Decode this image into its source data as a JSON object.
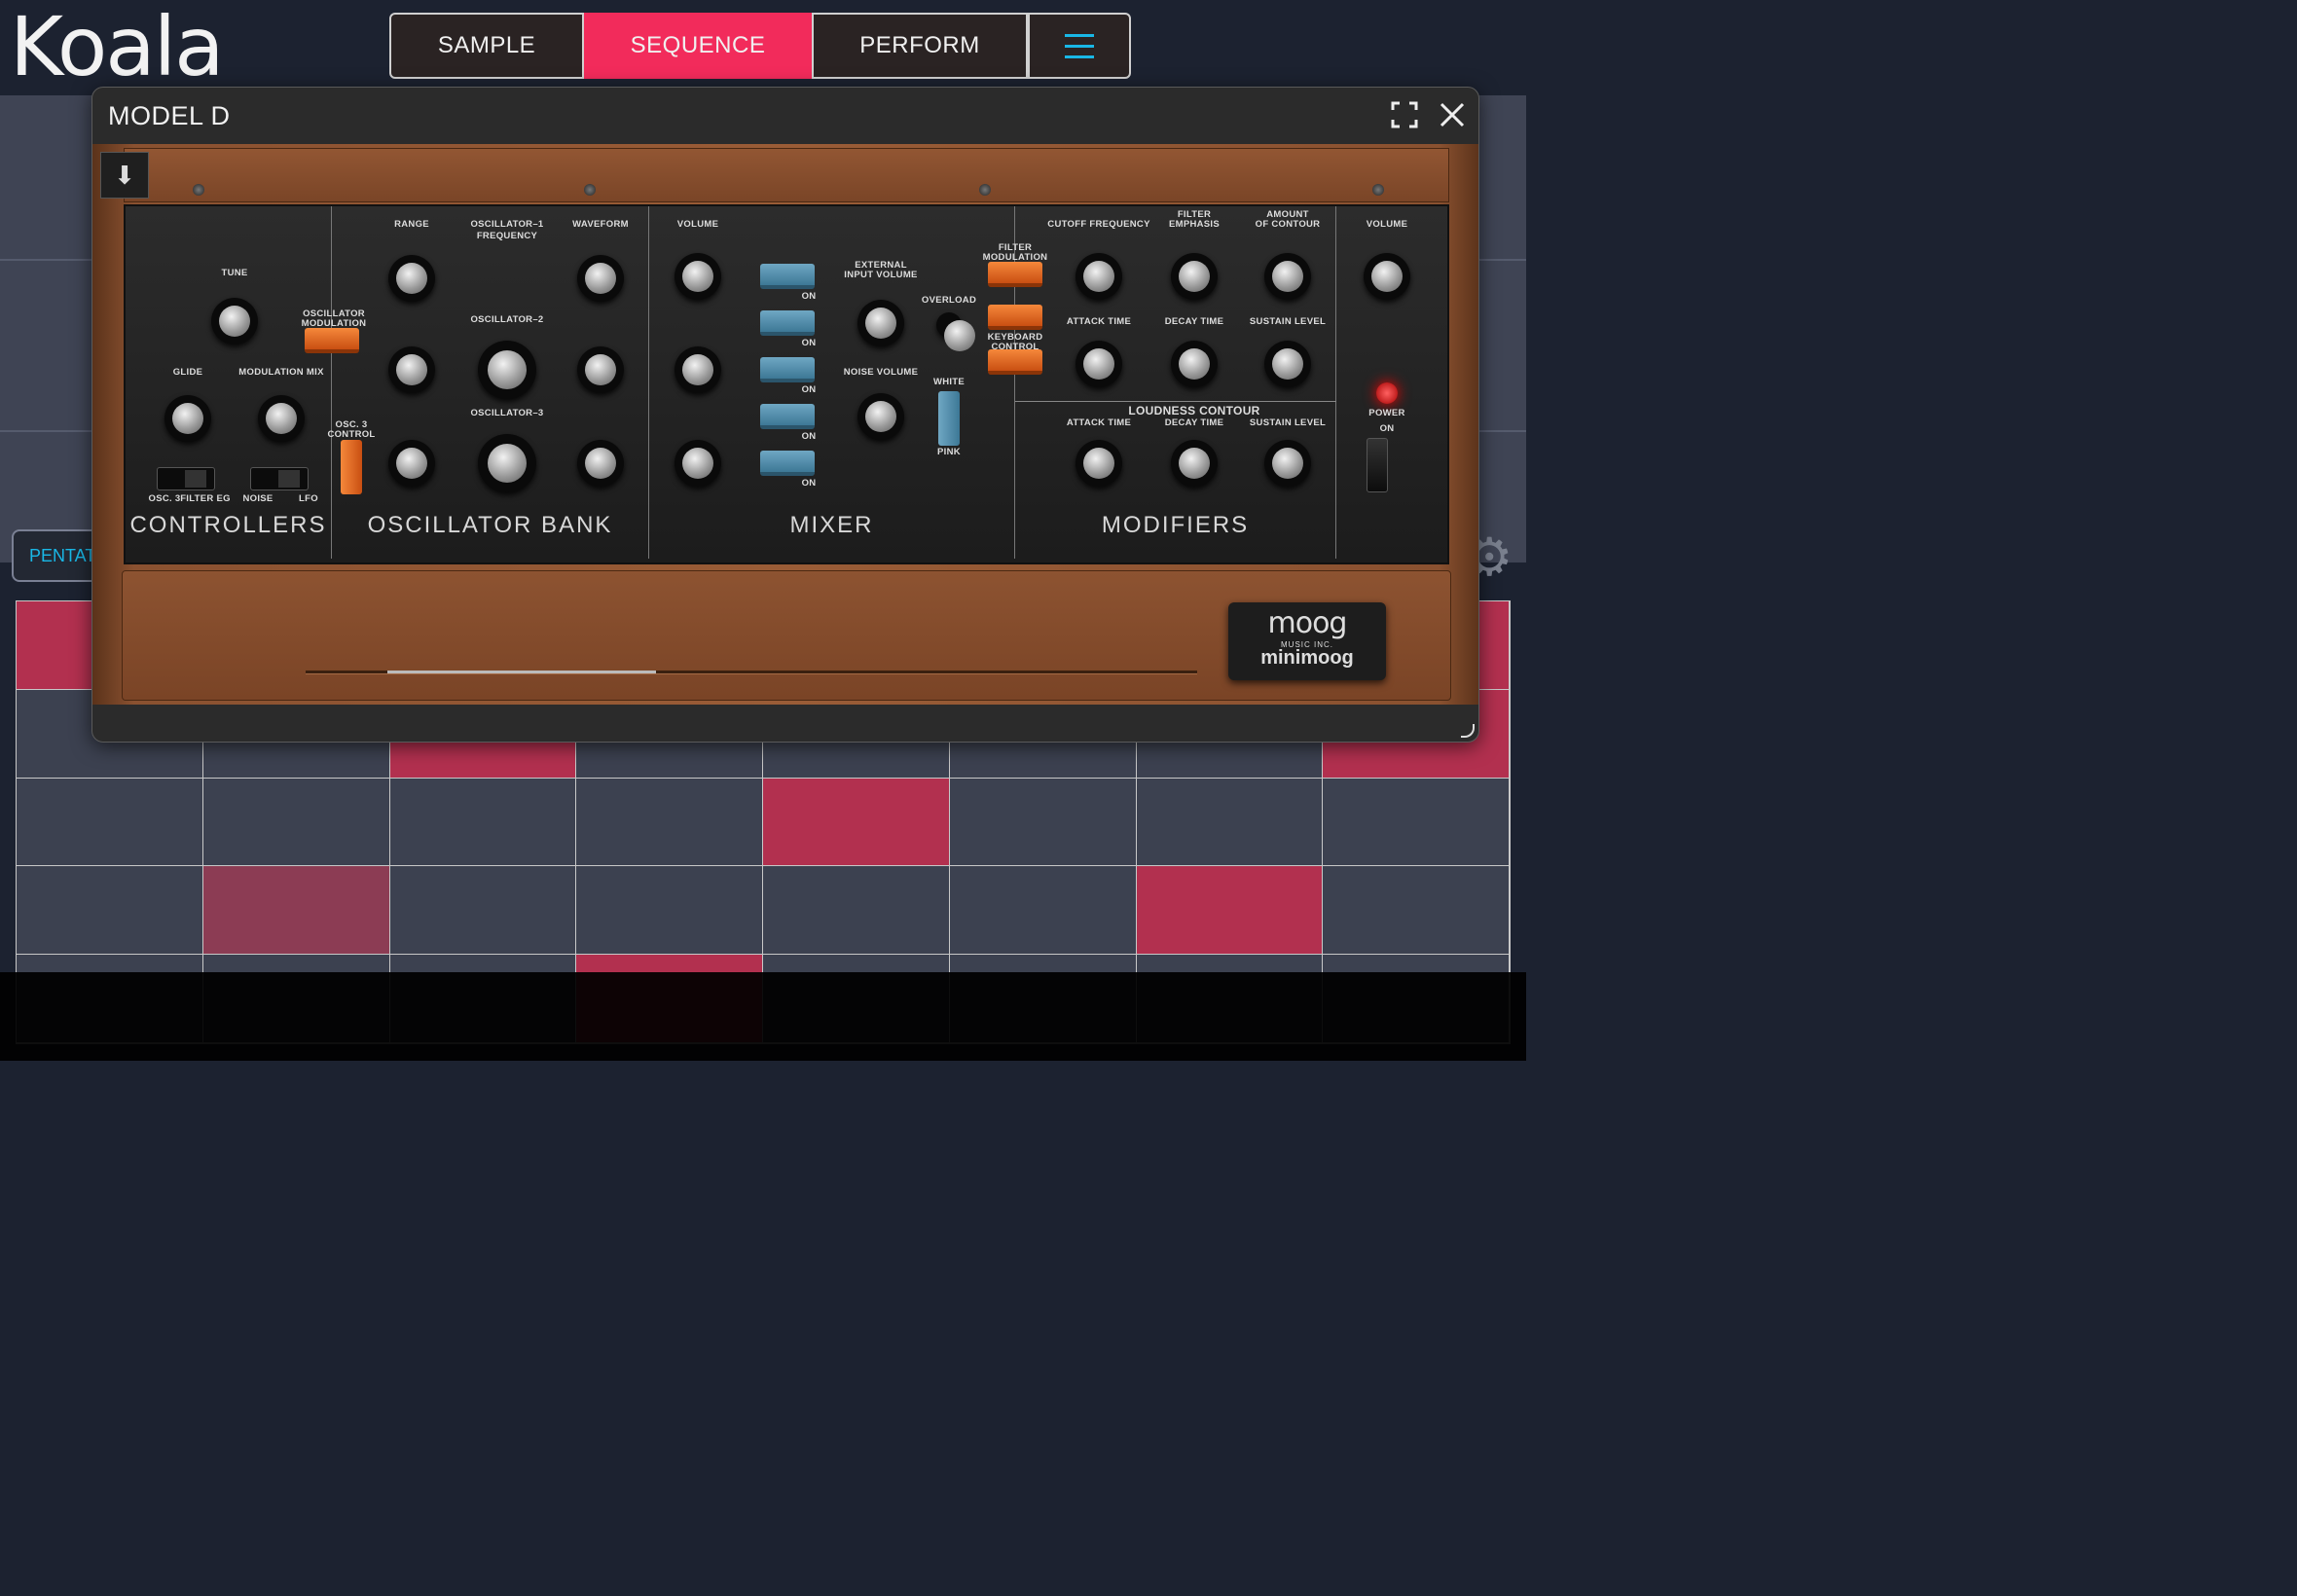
{
  "app": {
    "logo": "Koala"
  },
  "tabs": [
    {
      "label": "SAMPLE"
    },
    {
      "label": "SEQUENCE"
    },
    {
      "label": "PERFORM"
    }
  ],
  "colors": {
    "accent": "#f22b5b",
    "active_cell": "#b2304f",
    "menu_icon": "#19b7e6"
  },
  "sequencer": {
    "scale_button": "PENTATO",
    "grid": [
      [
        1,
        0,
        0,
        0,
        0,
        0,
        0,
        1
      ],
      [
        0,
        0,
        1,
        0,
        0,
        0,
        0,
        1
      ],
      [
        0,
        0,
        0,
        0,
        1,
        0,
        0,
        0
      ],
      [
        0,
        2,
        0,
        0,
        0,
        0,
        1,
        0
      ],
      [
        0,
        0,
        0,
        1,
        0,
        0,
        0,
        0
      ]
    ]
  },
  "plugin": {
    "title": "MODEL D",
    "sections": {
      "controllers": "CONTROLLERS",
      "oscillator_bank": "OSCILLATOR  BANK",
      "mixer": "MIXER",
      "modifiers": "MODIFIERS"
    },
    "labels": {
      "tune": "TUNE",
      "osc_mod": "OSCILLATOR\nMODULATION",
      "glide": "GLIDE",
      "mod_mix": "MODULATION MIX",
      "osc3_filter": "OSC. 3",
      "filter_eg": "FILTER EG",
      "osc3_filtereg": "OSC. 3/\nFILTER EG",
      "noise_lfo": "NOISE/\nLFO",
      "noise": "NOISE",
      "lfo": "LFO",
      "range": "RANGE",
      "osc1": "OSCILLATOR–1",
      "frequency": "FREQUENCY",
      "waveform": "WAVEFORM",
      "osc2": "OSCILLATOR–2",
      "osc3": "OSCILLATOR–3",
      "osc3_control": "OSC. 3\nCONTROL",
      "volume": "VOLUME",
      "ext_input": "EXTERNAL\nINPUT VOLUME",
      "overload": "OVERLOAD",
      "noise_volume": "NOISE VOLUME",
      "white": "WHITE",
      "pink": "PINK",
      "on": "ON",
      "filter_mod": "FILTER\nMODULATION",
      "keyboard_control": "KEYBOARD\nCONTROL",
      "cutoff": "CUTOFF  FREQUENCY",
      "filter_emphasis": "FILTER\nEMPHASIS",
      "amount_contour": "AMOUNT\nOF CONTOUR",
      "attack_time": "ATTACK TIME",
      "decay_time": "DECAY TIME",
      "sustain_level": "SUSTAIN LEVEL",
      "loudness_contour": "LOUDNESS CONTOUR",
      "master_volume": "VOLUME",
      "power": "POWER",
      "power_on": "ON"
    },
    "brand": {
      "logo": "moog",
      "sub": "MUSIC INC.",
      "model": "minimoog"
    }
  }
}
